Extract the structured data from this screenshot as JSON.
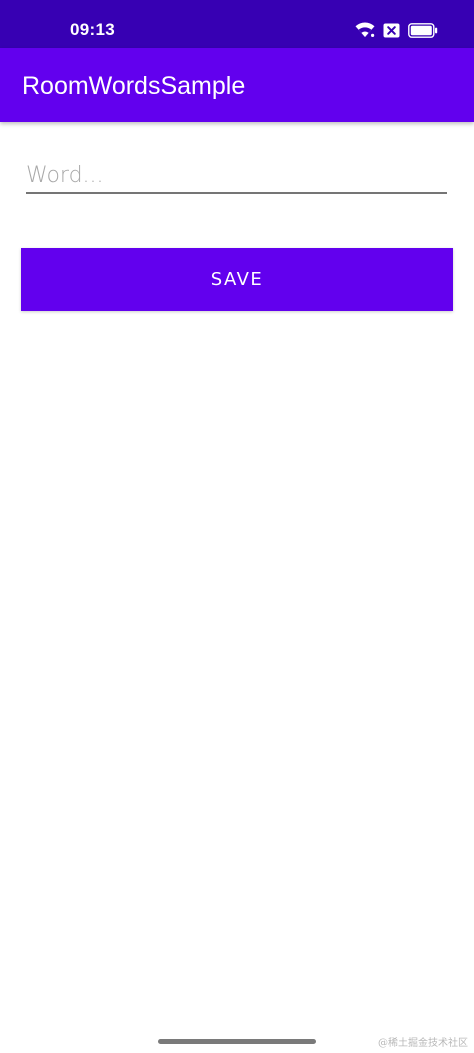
{
  "status_bar": {
    "time": "09:13",
    "icons": [
      "wifi-icon",
      "notification-x-icon",
      "battery-icon"
    ]
  },
  "app_bar": {
    "title": "RoomWordsSample"
  },
  "form": {
    "word_input_value": "",
    "word_input_placeholder": "Word...",
    "save_label": "SAVE"
  },
  "watermark": "@稀土掘金技术社区",
  "colors": {
    "status_bar": "#3700b3",
    "primary": "#6200ee",
    "background": "#ffffff"
  }
}
